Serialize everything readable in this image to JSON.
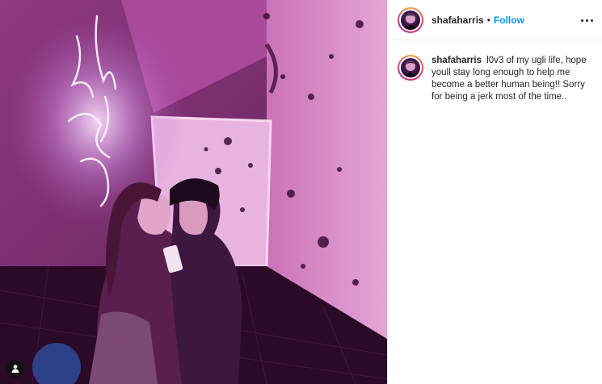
{
  "post": {
    "author": {
      "username": "shafaharris",
      "follow_label": "Follow",
      "separator": "•"
    },
    "more_icon": "more-horizontal-icon",
    "caption": {
      "username": "shafaharris",
      "text": "l0v3 of my ugli life, hope youll stay long enough to help me become a better human being!! Sorry for being a jerk most of the time.."
    },
    "tag_icon": "user-tag-icon",
    "colors": {
      "link_blue": "#0095f6",
      "text": "#262626",
      "divider": "#efefef",
      "photo_tint": "#b9509e"
    }
  }
}
